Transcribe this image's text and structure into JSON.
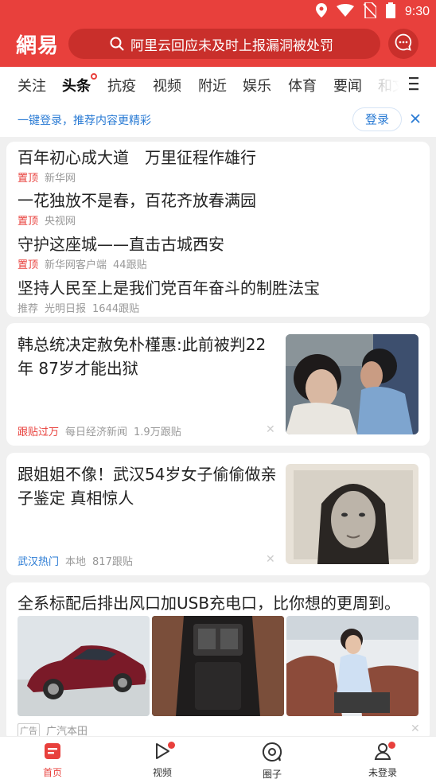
{
  "status_bar": {
    "time": "9:30"
  },
  "header": {
    "logo": "網易",
    "search_text": "阿里云回应未及时上报漏洞被处罚"
  },
  "tabs": [
    "关注",
    "头条",
    "抗疫",
    "视频",
    "附近",
    "娱乐",
    "体育",
    "要闻",
    "和文"
  ],
  "login_bar": {
    "text": "一键登录，推荐内容更精彩",
    "button": "登录"
  },
  "top_news": [
    {
      "title": "百年初心成大道　万里征程作雄行",
      "tag": "置顶",
      "source": "新华网",
      "count": ""
    },
    {
      "title": "一花独放不是春，百花齐放春满园",
      "tag": "置顶",
      "source": "央视网",
      "count": ""
    },
    {
      "title": "守护这座城——直击古城西安",
      "tag": "置顶",
      "source": "新华网客户端",
      "count": "44跟贴"
    },
    {
      "title": "坚持人民至上是我们党百年奋斗的制胜法宝",
      "tag": "推荐",
      "source": "光明日报",
      "count": "1644跟贴"
    }
  ],
  "news": [
    {
      "title": "韩总统决定赦免朴槿惠:此前被判22年 87岁才能出狱",
      "tag": "跟贴过万",
      "source": "每日经济新闻",
      "count": "1.9万跟贴"
    },
    {
      "title": "跟姐姐不像！武汉54岁女子偷偷做亲子鉴定 真相惊人",
      "tag": "武汉热门",
      "source": "本地",
      "count": "817跟贴"
    }
  ],
  "ad": {
    "title": "全系标配后排出风口加USB充电口，比你想的更周到。",
    "badge": "广告",
    "advertiser": "广汽本田"
  },
  "bottom_nav": [
    "首页",
    "视频",
    "圈子",
    "未登录"
  ],
  "colors": {
    "brand_red": "#e8403c",
    "link_blue": "#2a7bd4"
  }
}
